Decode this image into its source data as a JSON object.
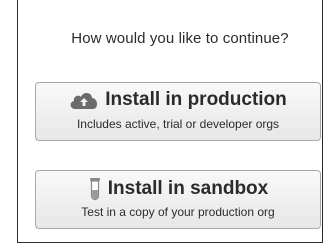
{
  "dialog": {
    "prompt": "How would you like to continue?"
  },
  "options": [
    {
      "label": "Install in production",
      "description": "Includes active, trial or developer orgs",
      "icon": "cloud-icon"
    },
    {
      "label": "Install in sandbox",
      "description": "Test in a copy of your production org",
      "icon": "test-tube-icon"
    }
  ]
}
